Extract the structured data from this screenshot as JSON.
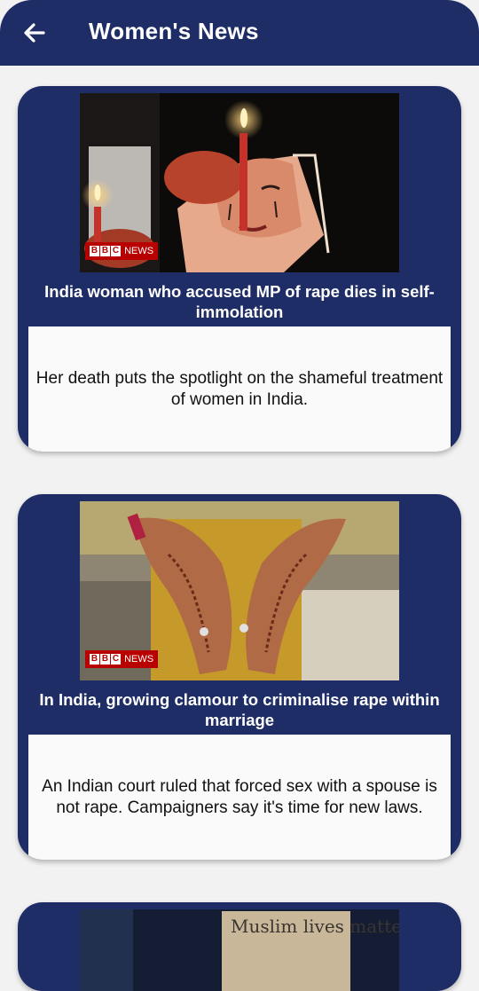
{
  "app_bar": {
    "title": "Women's News",
    "back_icon": "arrow-left-icon"
  },
  "colors": {
    "primary": "#1f2d66",
    "card_body": "#fafafa",
    "background": "#f2f2f2",
    "bbc_red": "#b80000"
  },
  "articles": [
    {
      "badge_letters": [
        "B",
        "B",
        "C"
      ],
      "badge_text": "NEWS",
      "title": "India woman who accused MP of rape dies in self-immolation",
      "description": "Her death puts the spotlight on the shameful treatment of women in India."
    },
    {
      "badge_letters": [
        "B",
        "B",
        "C"
      ],
      "badge_text": "NEWS",
      "title": "In India, growing clamour to criminalise rape within marriage",
      "description": "An Indian court ruled that forced sex with a spouse is not rape. Campaigners say it's time for new laws."
    },
    {
      "sign_text": "Muslim lives matter"
    }
  ]
}
